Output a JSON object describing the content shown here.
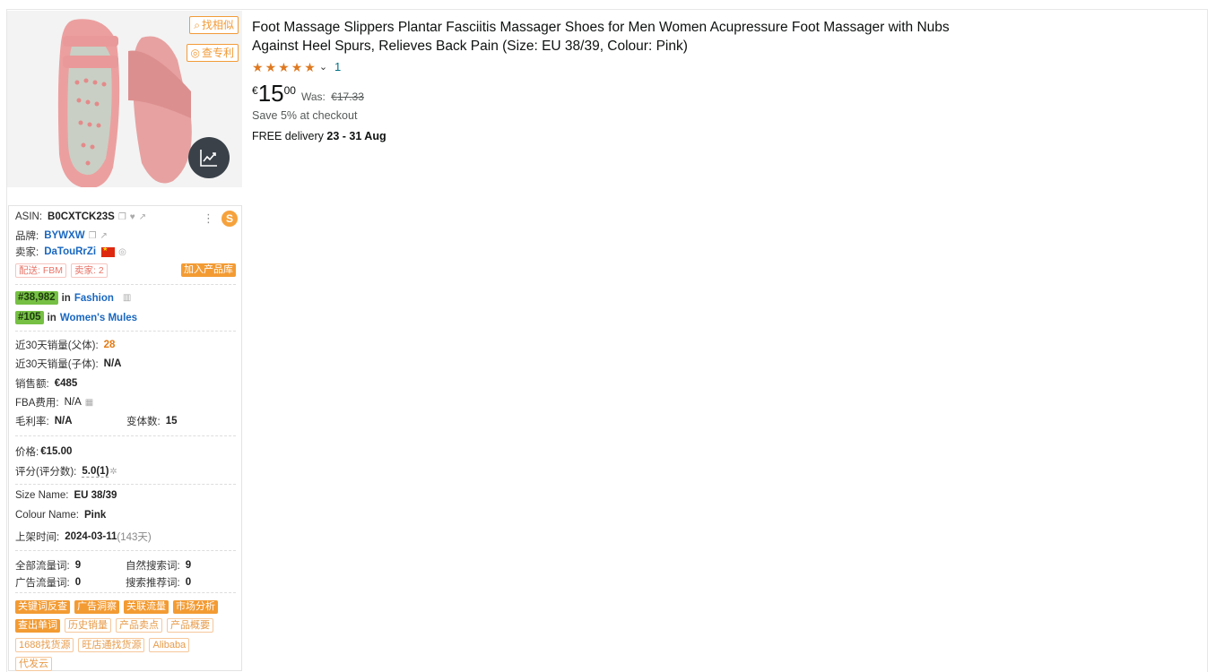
{
  "buttons": {
    "find_similar": "找相似",
    "check_patent": "查专利"
  },
  "product": {
    "title": "Foot Massage Slippers Plantar Fasciitis Massager Shoes for Men Women Acupressure Foot Massager with Nubs Against Heel Spurs, Relieves Back Pain (Size: EU 38/39, Colour: Pink)",
    "rating_count": "1",
    "currency": "€",
    "price_whole": "15",
    "price_fraction": "00",
    "was_label": "Was:",
    "was_price": "€17.33",
    "save": "Save 5% at checkout",
    "delivery_prefix": "FREE delivery",
    "delivery_dates": "23 - 31 Aug"
  },
  "panel": {
    "asin_label": "ASIN:",
    "asin": "B0CXTCK23S",
    "brand_label": "品牌:",
    "brand": "BYWXW",
    "seller_label": "卖家:",
    "seller": "DaTouRrZi",
    "tag_fbm": "配送: FBM",
    "tag_sellers": "卖家: 2",
    "add_library": "加入产品库",
    "rank1": "#38,982",
    "rank1_in": "in",
    "rank1_cat": "Fashion",
    "rank2": "#105",
    "rank2_in": "in",
    "rank2_cat": "Women's Mules",
    "sales30_parent_label": "近30天销量(父体):",
    "sales30_parent": "28",
    "sales30_child_label": "近30天销量(子体):",
    "sales30_child": "N/A",
    "revenue_label": "销售额:",
    "revenue": "€485",
    "fba_label": "FBA费用:",
    "fba": "N/A",
    "margin_label": "毛利率:",
    "margin": "N/A",
    "variants_label": "变体数:",
    "variants": "15",
    "price_label": "价格:",
    "price": "€15.00",
    "rating_label": "评分(评分数):",
    "rating": "5.0(1)",
    "size_label": "Size Name:",
    "size": "EU 38/39",
    "colour_label": "Colour Name:",
    "colour": "Pink",
    "listed_label": "上架时间:",
    "listed": "2024-03-11",
    "listed_days": "(143天)",
    "kw_all_label": "全部流量词:",
    "kw_all": "9",
    "kw_organic_label": "自然搜索词:",
    "kw_organic": "9",
    "kw_ads_label": "广告流量词:",
    "kw_ads": "0",
    "kw_rec_label": "搜索推荐词:",
    "kw_rec": "0",
    "tools_row1": [
      "关键词反查",
      "广告洞察",
      "关联流量",
      "市场分析"
    ],
    "tools_row2_fill": "查出单词",
    "tools_row2": [
      "历史销量",
      "产品卖点",
      "产品概要"
    ],
    "tools_row3": [
      "1688找货源",
      "旺店通找货源",
      "Alibaba"
    ],
    "tools_row4": [
      "代发云"
    ]
  },
  "colors": {
    "accent": "#f39b33",
    "link": "#007185",
    "star": "#de7921",
    "badge": "#76c043"
  }
}
